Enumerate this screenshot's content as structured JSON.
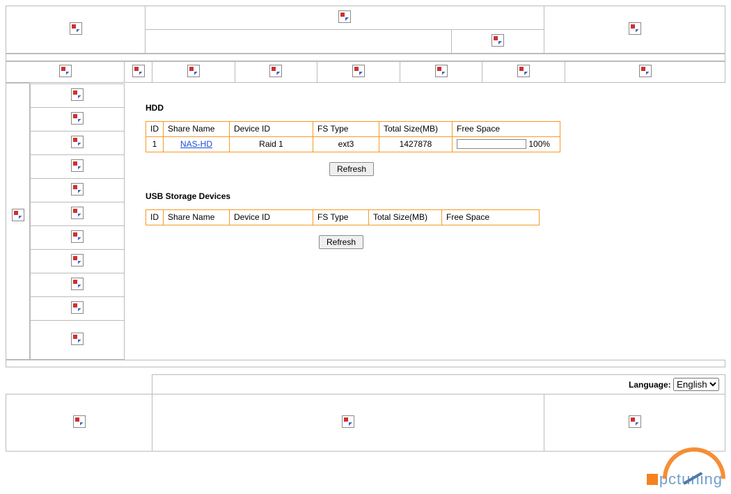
{
  "sections": {
    "hdd_title": "HDD",
    "usb_title": "USB Storage Devices"
  },
  "columns": {
    "id": "ID",
    "share_name": "Share Name",
    "device_id": "Device ID",
    "fs_type": "FS Type",
    "total_size": "Total Size(MB)",
    "free_space": "Free Space"
  },
  "hdd_rows": [
    {
      "id": "1",
      "share_name": "NAS-HD",
      "device_id": "Raid 1",
      "fs_type": "ext3",
      "total_size": "1427878",
      "free_pct_label": "100%"
    }
  ],
  "buttons": {
    "refresh": "Refresh"
  },
  "footer": {
    "language_label": "Language:",
    "language_value": "English"
  },
  "watermark": {
    "text": "pctuning"
  }
}
